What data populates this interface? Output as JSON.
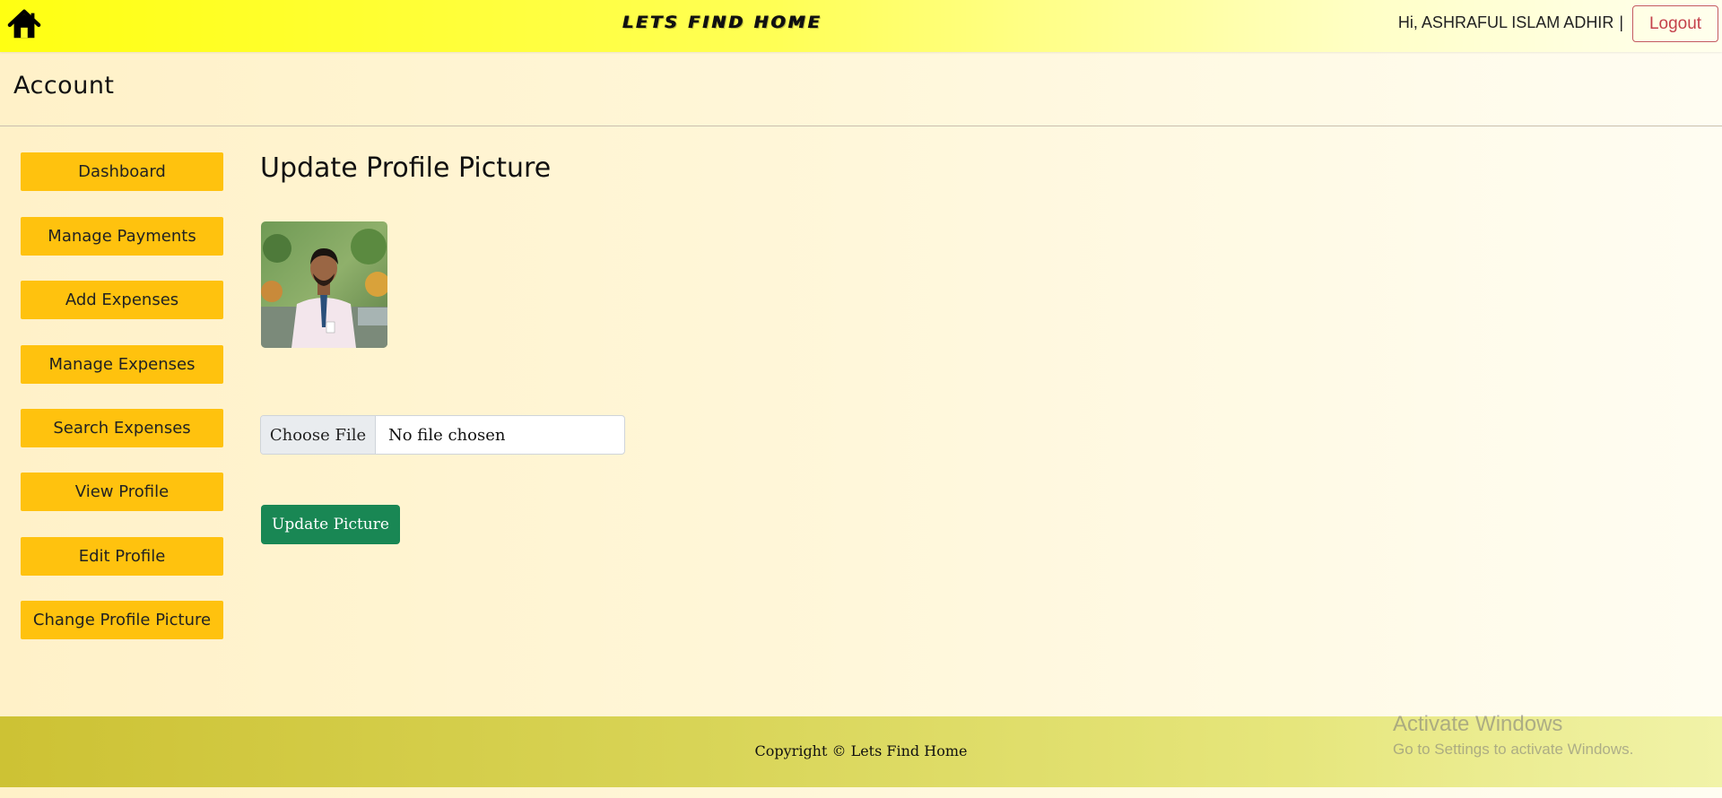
{
  "header": {
    "home_icon": "home-icon",
    "brand": "LETS FIND HOME",
    "greeting": "Hi, ASHRAFUL ISLAM ADHIR",
    "separator": "|",
    "logout_label": "Logout"
  },
  "page": {
    "title": "Account"
  },
  "sidebar": {
    "items": [
      {
        "label": "Dashboard"
      },
      {
        "label": "Manage Payments"
      },
      {
        "label": "Add Expenses"
      },
      {
        "label": "Manage Expenses"
      },
      {
        "label": "Search Expenses"
      },
      {
        "label": "View Profile"
      },
      {
        "label": "Edit Profile"
      },
      {
        "label": "Change Profile Picture"
      }
    ]
  },
  "main": {
    "section_title": "Update Profile Picture",
    "file_input": {
      "button_label": "Choose File",
      "status": "No file chosen"
    },
    "submit_label": "Update Picture"
  },
  "footer": {
    "copyright": "Copyright © Lets Find Home"
  },
  "watermark": {
    "title": "Activate Windows",
    "subtitle": "Go to Settings to activate Windows."
  },
  "colors": {
    "sidebar_button": "#ffc20e",
    "submit_button": "#198754",
    "logout_border": "#c45a62",
    "header_yellow": "#ffff12"
  }
}
